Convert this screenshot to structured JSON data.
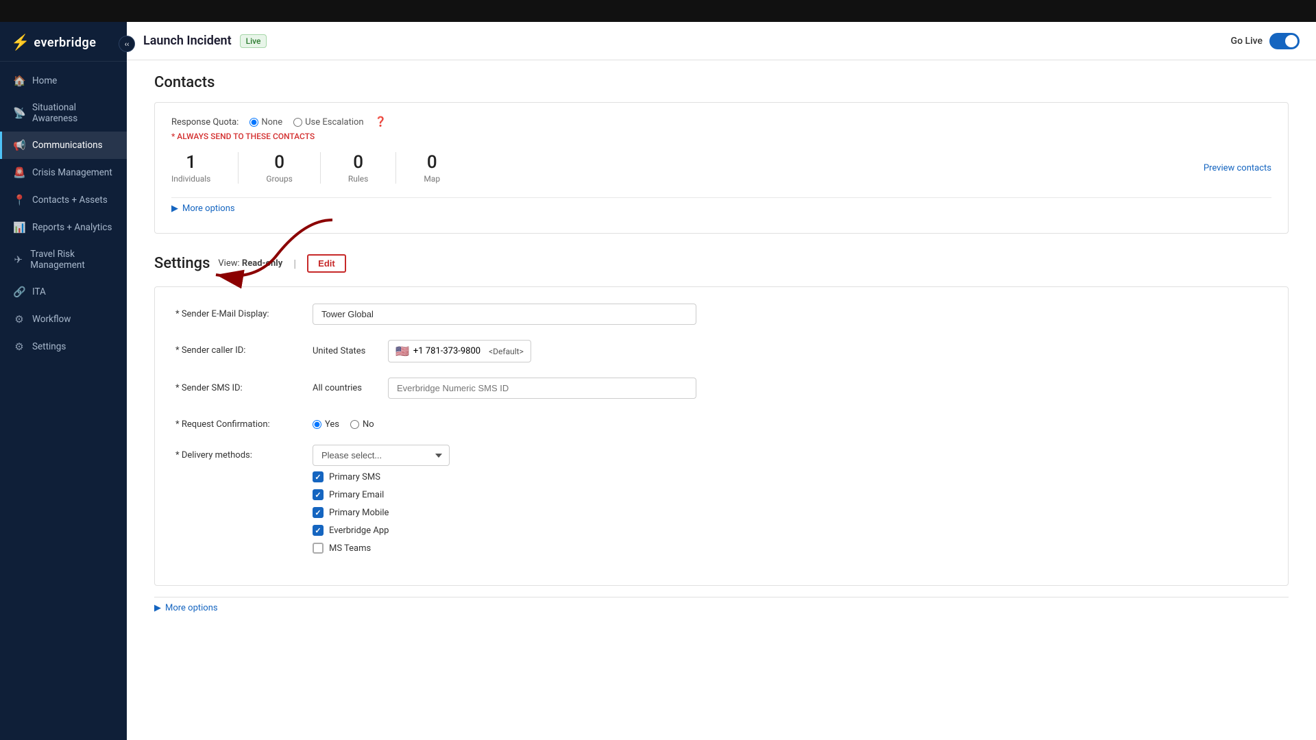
{
  "sidebar": {
    "logo": "everbridge",
    "logo_icon": "⚡",
    "items": [
      {
        "id": "home",
        "label": "Home",
        "icon": "🏠",
        "active": false
      },
      {
        "id": "situational-awareness",
        "label": "Situational Awareness",
        "icon": "📡",
        "active": false
      },
      {
        "id": "communications",
        "label": "Communications",
        "icon": "📢",
        "active": true
      },
      {
        "id": "crisis-management",
        "label": "Crisis Management",
        "icon": "🚨",
        "active": false
      },
      {
        "id": "contacts-assets",
        "label": "Contacts + Assets",
        "icon": "📍",
        "active": false
      },
      {
        "id": "reports-analytics",
        "label": "Reports + Analytics",
        "icon": "📊",
        "active": false
      },
      {
        "id": "travel-risk",
        "label": "Travel Risk Management",
        "icon": "✈",
        "active": false
      },
      {
        "id": "ita",
        "label": "ITA",
        "icon": "🔗",
        "active": false
      },
      {
        "id": "workflow",
        "label": "Workflow",
        "icon": "⚙",
        "active": false
      },
      {
        "id": "settings",
        "label": "Settings",
        "icon": "⚙",
        "active": false
      }
    ]
  },
  "topbar": {
    "title": "Launch Incident",
    "badge": "Live",
    "go_live_label": "Go Live"
  },
  "contacts_section": {
    "heading": "Contacts",
    "quota_label": "Response Quota:",
    "quota_none": "None",
    "quota_escalation": "Use Escalation",
    "always_send_label": "* ALWAYS SEND TO THESE CONTACTS",
    "stats": [
      {
        "value": "1",
        "label": "Individuals"
      },
      {
        "value": "0",
        "label": "Groups"
      },
      {
        "value": "0",
        "label": "Rules"
      },
      {
        "value": "0",
        "label": "Map"
      }
    ],
    "preview_link": "Preview contacts",
    "more_options": "More options"
  },
  "settings_section": {
    "heading": "Settings",
    "view_label": "View:",
    "view_mode": "Read-only",
    "edit_button": "Edit",
    "sender_email_label": "* Sender E-Mail Display:",
    "sender_email_value": "Tower Global",
    "sender_caller_label": "* Sender caller ID:",
    "caller_country": "United States",
    "caller_phone": "+1 781-373-9800",
    "caller_default": "<Default>",
    "sender_sms_label": "* Sender SMS ID:",
    "sms_country": "All countries",
    "sms_placeholder": "Everbridge Numeric SMS ID",
    "request_confirmation_label": "* Request Confirmation:",
    "confirmation_yes": "Yes",
    "confirmation_no": "No",
    "delivery_methods_label": "* Delivery methods:",
    "delivery_placeholder": "Please select...",
    "delivery_options": [
      {
        "id": "primary-sms",
        "label": "Primary SMS",
        "checked": true
      },
      {
        "id": "primary-email",
        "label": "Primary Email",
        "checked": true
      },
      {
        "id": "primary-mobile",
        "label": "Primary Mobile",
        "checked": true
      },
      {
        "id": "everbridge-app",
        "label": "Everbridge App",
        "checked": true
      },
      {
        "id": "ms-teams",
        "label": "MS Teams",
        "checked": false
      }
    ],
    "more_options": "More options"
  },
  "colors": {
    "accent_blue": "#1565c0",
    "danger_red": "#c62828",
    "sidebar_bg": "#0f1f38",
    "active_nav": "#4fc3f7"
  }
}
